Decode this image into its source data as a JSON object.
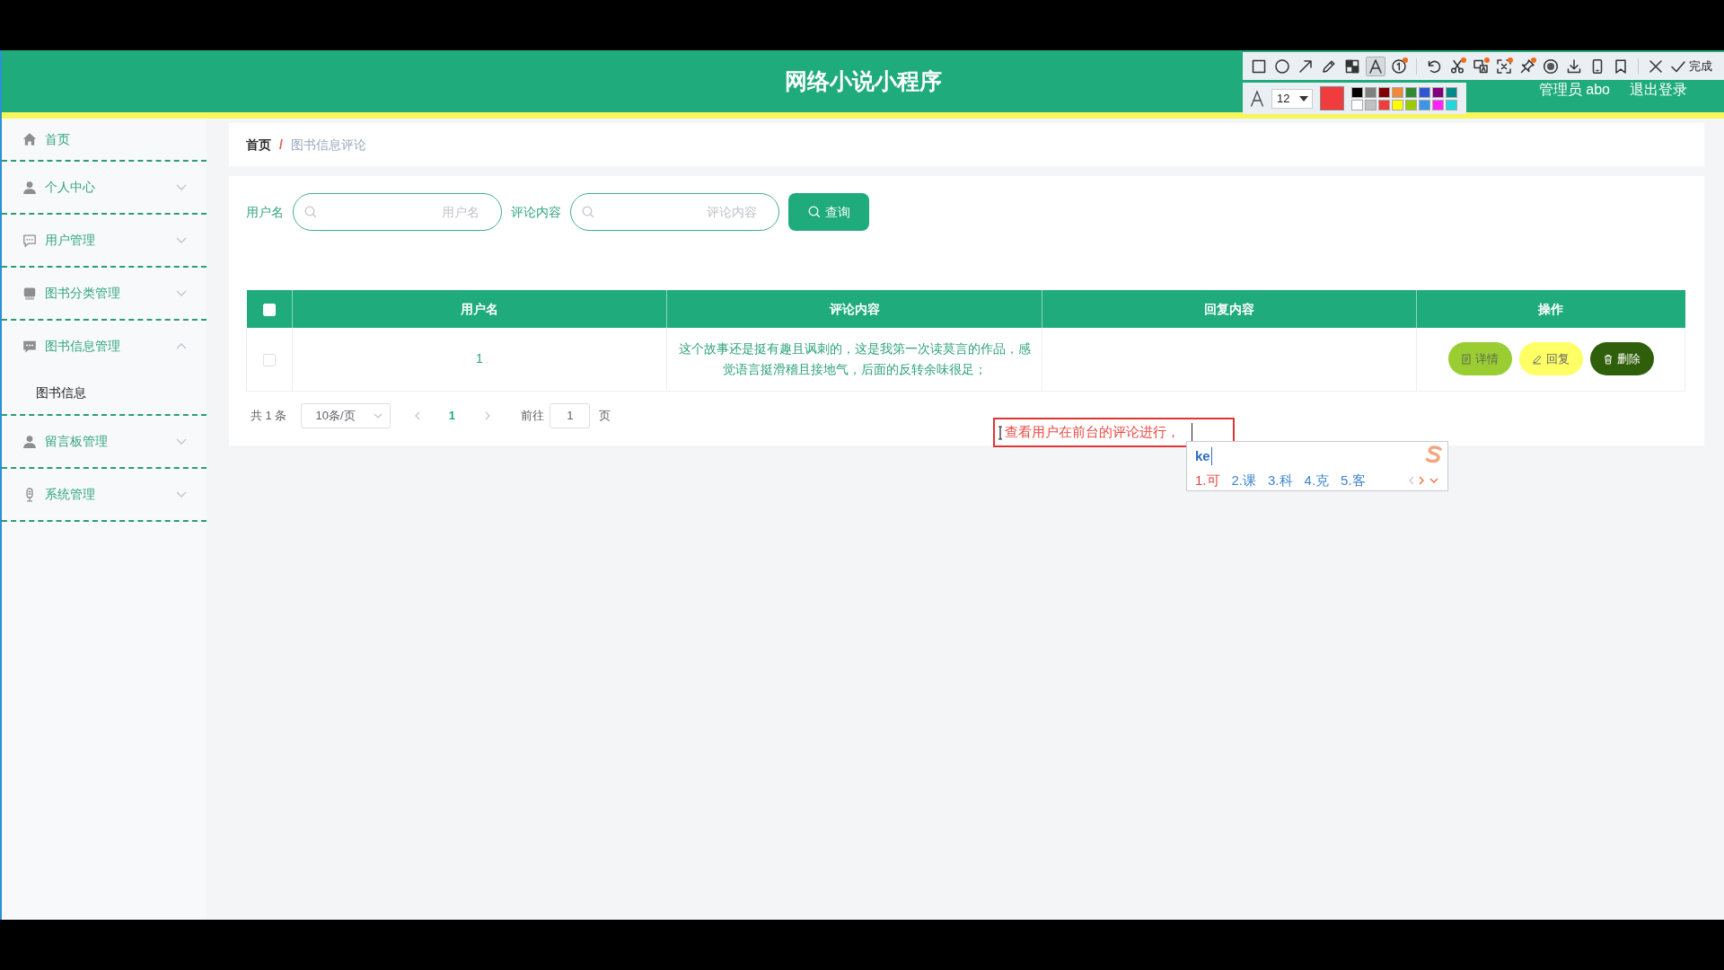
{
  "header": {
    "title": "网络小说小程序",
    "user": "管理员 abo",
    "logout": "退出登录"
  },
  "capture_toolbar": {
    "tool_groups": [
      {
        "tools": [
          {
            "kind": "rectangle",
            "selected": false,
            "badge": false
          },
          {
            "kind": "ellipse",
            "selected": false,
            "badge": false
          },
          {
            "kind": "arrow",
            "selected": false,
            "badge": false
          },
          {
            "kind": "pencil",
            "selected": false,
            "badge": false
          },
          {
            "kind": "mosaic",
            "selected": false,
            "badge": false
          },
          {
            "kind": "text",
            "selected": true,
            "badge": false
          },
          {
            "kind": "number",
            "selected": false,
            "badge": true
          }
        ]
      },
      {
        "tools": [
          {
            "kind": "undo",
            "selected": false,
            "badge": false
          },
          {
            "kind": "cut",
            "selected": false,
            "badge": true
          },
          {
            "kind": "translate",
            "selected": false,
            "badge": true
          },
          {
            "kind": "scan",
            "selected": false,
            "badge": true
          },
          {
            "kind": "pin",
            "selected": false,
            "badge": true
          },
          {
            "kind": "record",
            "selected": false,
            "badge": false
          },
          {
            "kind": "download",
            "selected": false,
            "badge": false
          },
          {
            "kind": "phone",
            "selected": false,
            "badge": false
          },
          {
            "kind": "bookmark",
            "selected": false,
            "badge": false
          }
        ]
      },
      {
        "tools": [
          {
            "kind": "close",
            "selected": false,
            "badge": false
          },
          {
            "kind": "done",
            "selected": false,
            "badge": false,
            "label": "完成"
          }
        ]
      }
    ],
    "font_size": "12",
    "palette": [
      {
        "color": "#000000",
        "selected": false
      },
      {
        "color": "#808080",
        "selected": false
      },
      {
        "color": "#800000",
        "selected": false
      },
      {
        "color": "#f0883a",
        "selected": false
      },
      {
        "color": "#2f8a34",
        "selected": false
      },
      {
        "color": "#3057d6",
        "selected": false
      },
      {
        "color": "#800080",
        "selected": false
      },
      {
        "color": "#008b8b",
        "selected": false
      },
      {
        "color": "#ffffff",
        "selected": false
      },
      {
        "color": "#c0c0c0",
        "selected": false
      },
      {
        "color": "#f03c3c",
        "selected": true
      },
      {
        "color": "#ffff00",
        "selected": false
      },
      {
        "color": "#99cc00",
        "selected": false
      },
      {
        "color": "#3a96e8",
        "selected": false
      },
      {
        "color": "#ff22ff",
        "selected": false
      },
      {
        "color": "#22d6e0",
        "selected": false
      }
    ]
  },
  "sidebar": {
    "items": [
      {
        "kind": "link",
        "label": "首页"
      },
      {
        "kind": "menu",
        "label": "个人中心",
        "expanded": false
      },
      {
        "kind": "menu",
        "label": "用户管理",
        "expanded": false
      },
      {
        "kind": "menu",
        "label": "图书分类管理",
        "expanded": false
      },
      {
        "kind": "menu",
        "label": "图书信息管理",
        "expanded": true,
        "children": [
          {
            "label": "图书信息"
          }
        ]
      },
      {
        "kind": "menu",
        "label": "留言板管理",
        "expanded": false
      },
      {
        "kind": "menu",
        "label": "系统管理",
        "expanded": false
      }
    ]
  },
  "breadcrumb": {
    "separator": "/",
    "items": [
      {
        "label": "首页",
        "current": false
      },
      {
        "label": "图书信息评论",
        "current": true
      }
    ]
  },
  "search": {
    "fields": [
      {
        "label": "用户名",
        "placeholder": "用户名"
      },
      {
        "label": "评论内容",
        "placeholder": "评论内容"
      }
    ],
    "button": "查询"
  },
  "table": {
    "select_all": {
      "checked": false
    },
    "columns": [
      "用户名",
      "评论内容",
      "回复内容",
      "操作"
    ],
    "rows": [
      {
        "checked": false,
        "username": "1",
        "comment": "这个故事还是挺有趣且讽刺的，这是我第一次读莫言的作品，感觉语言挺滑稽且接地气，后面的反转余味很足；",
        "actions": [
          {
            "kind": "detail",
            "label": "详情"
          },
          {
            "kind": "reply",
            "label": "回复"
          },
          {
            "kind": "delete",
            "label": "删除"
          }
        ]
      }
    ]
  },
  "pagination": {
    "total": "共 1 条",
    "page_size": "10条/页",
    "pages": [
      {
        "label": "1",
        "selected": true
      }
    ],
    "goto_label": "前往",
    "goto_value": "1",
    "goto_suffix": "页"
  },
  "annotation": {
    "text": "查看用户在前台的评论进行，"
  },
  "ime": {
    "input": "ke",
    "candidates": [
      {
        "label": "1.可",
        "selected": true
      },
      {
        "label": "2.课",
        "selected": false
      },
      {
        "label": "3.科",
        "selected": false
      },
      {
        "label": "4.克",
        "selected": false
      },
      {
        "label": "5.客",
        "selected": false
      }
    ]
  }
}
